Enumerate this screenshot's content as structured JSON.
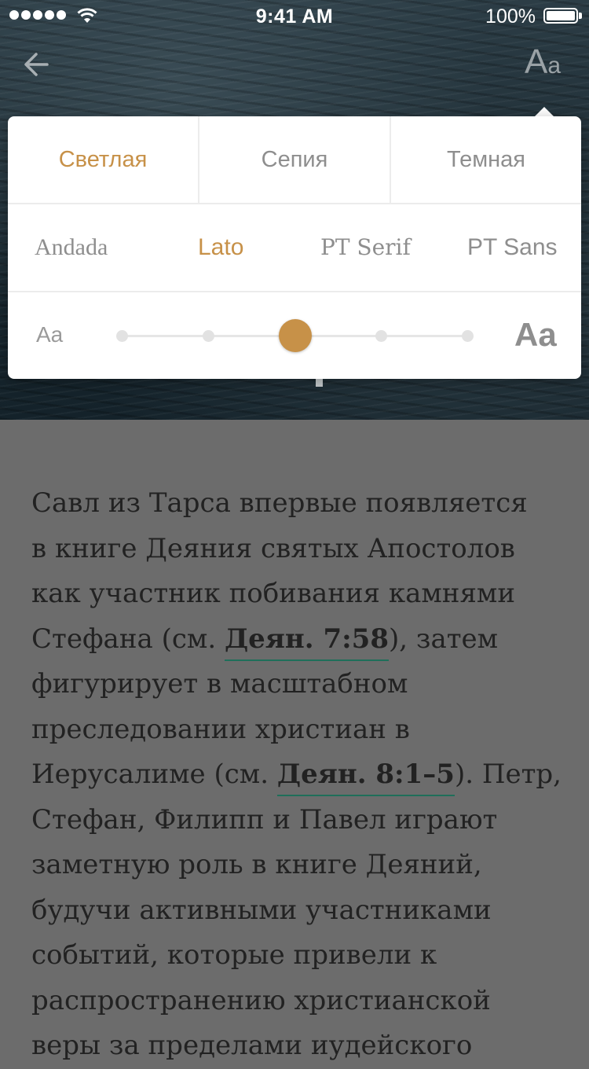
{
  "status_bar": {
    "time": "9:41 AM",
    "battery_percent": "100%",
    "signal_bars": 5,
    "icons": [
      "signal-dots-icon",
      "wifi-icon",
      "battery-icon"
    ]
  },
  "nav": {
    "back_icon": "arrow-left-icon",
    "font_button": {
      "big": "A",
      "small": "a"
    }
  },
  "settings": {
    "themes": [
      {
        "label": "Светлая",
        "active": true
      },
      {
        "label": "Сепия",
        "active": false
      },
      {
        "label": "Темная",
        "active": false
      }
    ],
    "fonts": [
      {
        "label": "Andada",
        "active": false
      },
      {
        "label": "Lato",
        "active": true
      },
      {
        "label": "PT Serif",
        "active": false
      },
      {
        "label": "PT Sans",
        "active": false
      }
    ],
    "size": {
      "small_label": "Aa",
      "large_label": "Aa",
      "steps": 5,
      "selected_step": 3
    },
    "accent_color": "#c79148"
  },
  "article": {
    "line1": "Савл из Тарса впервые появляется",
    "line2": "в книге Деяния святых Апостолов",
    "line3": "как участник побивания камнями",
    "line4_before": "Стефана (см. ",
    "line4_link": "Деян. 7:58",
    "line4_after": "), затем",
    "line5": "фигурирует в масштабном",
    "line6": "преследовании христиан в",
    "line7_before": "Иерусалиме (см. ",
    "line7_link": "Деян. 8:1–5",
    "line7_after": "). Петр,",
    "line8": "Стефан, Филипп и Павел играют",
    "line9": "заметную роль в книге Деяний,",
    "line10": "будучи активными участниками",
    "line11": "событий, которые привели к",
    "line12": "распространению христианской",
    "line13": "веры за пределами иудейского",
    "link_underline_color": "#1f6f5a"
  }
}
